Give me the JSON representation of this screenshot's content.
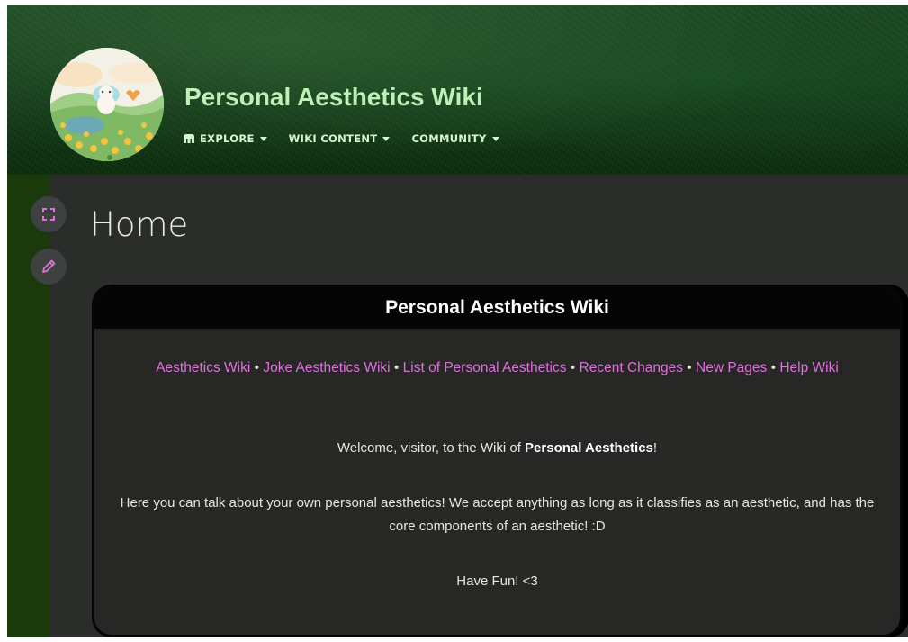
{
  "header": {
    "wiki_title": "Personal Aesthetics Wiki",
    "avatar_name": "wiki-avatar",
    "nav": [
      {
        "label": "EXPLORE",
        "icon": "explore-icon"
      },
      {
        "label": "WIKI CONTENT"
      },
      {
        "label": "COMMUNITY"
      }
    ]
  },
  "sidebar": {
    "buttons": [
      {
        "name": "fullscreen-button",
        "icon": "expand-icon"
      },
      {
        "name": "edit-button",
        "icon": "pencil-icon"
      }
    ]
  },
  "page": {
    "title": "Home"
  },
  "infobox": {
    "title": "Personal Aesthetics Wiki",
    "links": [
      "Aesthetics Wiki",
      "Joke Aesthetics Wiki",
      "List of Personal Aesthetics",
      "Recent Changes",
      "New Pages",
      "Help Wiki"
    ],
    "separator": " • ",
    "welcome_prefix": "Welcome, visitor, to the Wiki of ",
    "welcome_bold": "Personal Aesthetics",
    "welcome_suffix": "!",
    "intro": "Here you can talk about your own personal aesthetics! We accept anything as long as it classifies as an aesthetic, and has the core components of an aesthetic! :D",
    "closing": "Have Fun! <3"
  },
  "colors": {
    "link": "#df6fdc",
    "header_title": "#bff0b8",
    "content_bg": "#2b2d2a",
    "infobox_head": "#050505",
    "side_button": "#3e4140",
    "icon_accent": "#df6fdc"
  }
}
